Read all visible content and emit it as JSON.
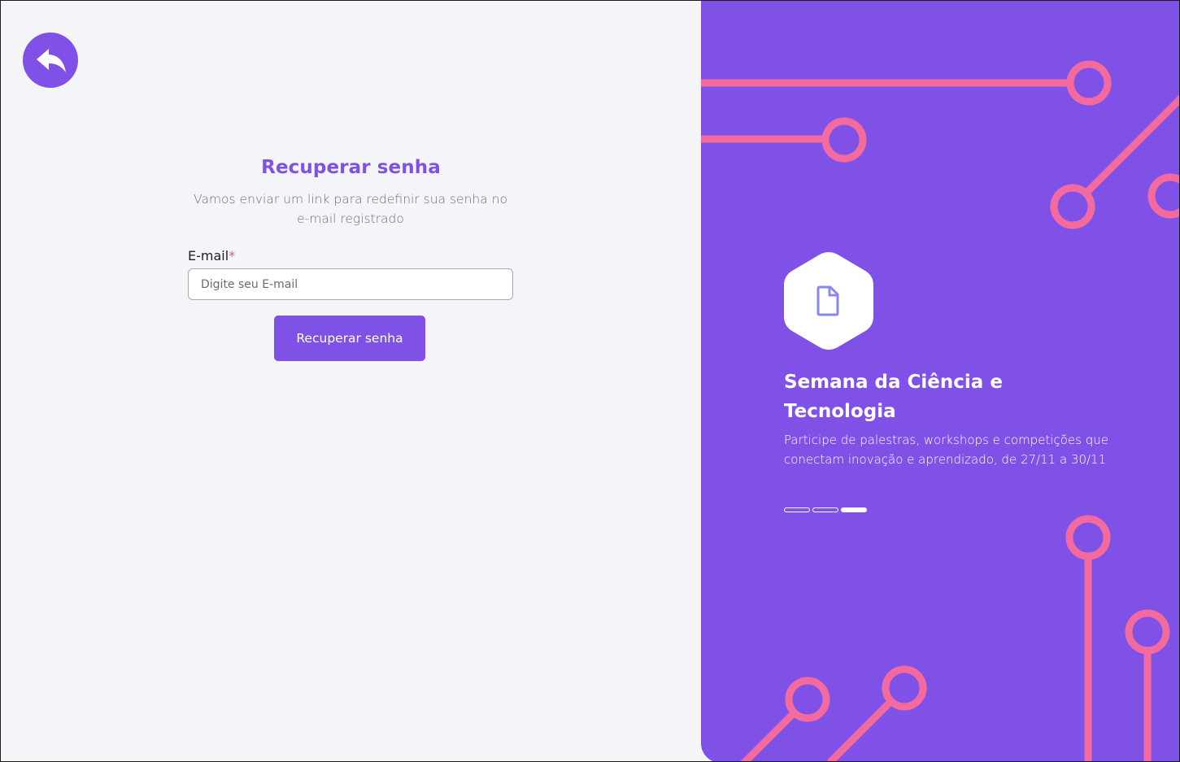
{
  "colors": {
    "accent": "#7f51e6",
    "page_background": "#f4f5f8",
    "required_marker": "#e05577",
    "circuit": "#f36b9e"
  },
  "back_button": {
    "icon": "reply-arrow-icon"
  },
  "form": {
    "title": "Recuperar senha",
    "subtitle": "Vamos enviar um link para redefinir sua senha no e-mail registrado",
    "email_label": "E-mail",
    "required_mark": "*",
    "email_placeholder": "Digite seu E-mail",
    "email_value": "",
    "submit_label": "Recuperar senha"
  },
  "promo": {
    "icon": "document-icon",
    "title": "Semana da Ciência e Tecnologia",
    "description": "Participe de palestras, workshops e competições que conectam inovação e aprendizado, de 27/11 a 30/11",
    "slides_total": 3,
    "active_slide": 3
  }
}
